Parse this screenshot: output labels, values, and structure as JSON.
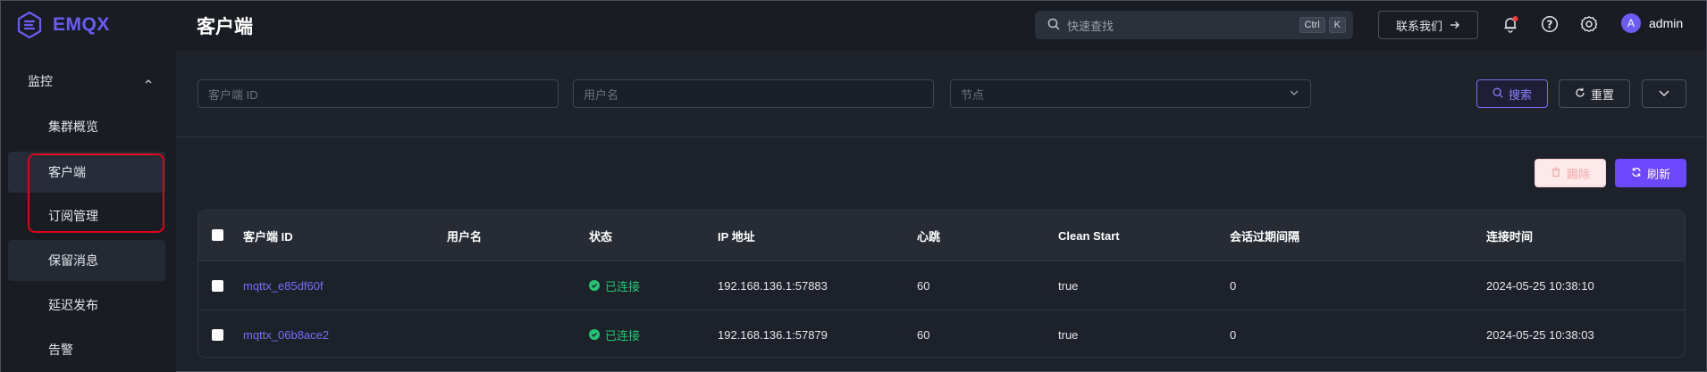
{
  "app": {
    "name": "EMQX"
  },
  "sidebar": {
    "group": {
      "label": "监控"
    },
    "items": [
      {
        "label": "集群概览"
      },
      {
        "label": "客户端"
      },
      {
        "label": "订阅管理"
      },
      {
        "label": "保留消息"
      },
      {
        "label": "延迟发布"
      },
      {
        "label": "告警"
      }
    ]
  },
  "header": {
    "title": "客户端",
    "search_placeholder": "快速查找",
    "shortcut_keys": [
      "Ctrl",
      "K"
    ],
    "contact_label": "联系我们",
    "user": {
      "avatar_letter": "A",
      "name": "admin"
    }
  },
  "filters": {
    "client_id_placeholder": "客户端 ID",
    "username_placeholder": "用户名",
    "node_placeholder": "节点",
    "search_label": "搜索",
    "reset_label": "重置"
  },
  "actions": {
    "kick_label": "踢除",
    "refresh_label": "刷新"
  },
  "table": {
    "columns": [
      "客户端 ID",
      "用户名",
      "状态",
      "IP 地址",
      "心跳",
      "Clean Start",
      "会话过期间隔",
      "连接时间"
    ],
    "rows": [
      {
        "client_id": "mqttx_e85df60f",
        "username": "",
        "status": "已连接",
        "ip": "192.168.136.1:57883",
        "keepalive": "60",
        "clean_start": "true",
        "expiry": "0",
        "connected_at": "2024-05-25 10:38:10"
      },
      {
        "client_id": "mqttx_06b8ace2",
        "username": "",
        "status": "已连接",
        "ip": "192.168.136.1:57879",
        "keepalive": "60",
        "clean_start": "true",
        "expiry": "0",
        "connected_at": "2024-05-25 10:38:03"
      }
    ]
  },
  "colors": {
    "accent": "#6b48ff",
    "link": "#7b6cf9",
    "success": "#24c474",
    "highlight_box": "#e0001b"
  }
}
